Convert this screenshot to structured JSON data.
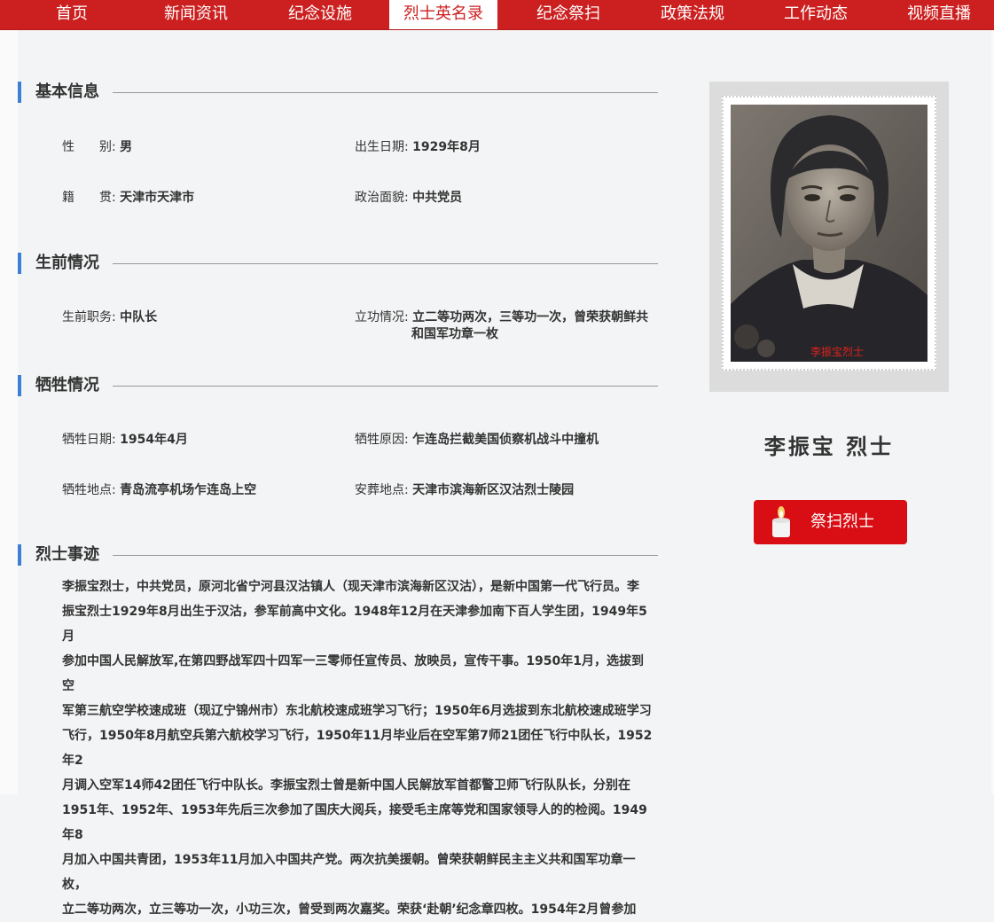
{
  "nav": {
    "items": [
      {
        "label": "首页"
      },
      {
        "label": "新闻资讯"
      },
      {
        "label": "纪念设施"
      },
      {
        "label": "烈士英名录"
      },
      {
        "label": "纪念祭扫"
      },
      {
        "label": "政策法规"
      },
      {
        "label": "工作动态"
      },
      {
        "label": "视频直播"
      }
    ],
    "active_index": 3
  },
  "sections": {
    "basic": {
      "title": "基本信息",
      "gender_label": "性　　别:",
      "gender": "男",
      "birth_label": "出生日期:",
      "birth": "1929年8月",
      "native_label": "籍　　贯:",
      "native": "天津市天津市",
      "political_label": "政治面貌:",
      "political": "中共党员"
    },
    "life": {
      "title": "生前情况",
      "post_label": "生前职务:",
      "post": "中队长",
      "merit_label": "立功情况:",
      "merit_line1": "立二等功两次，三等功一次，曾荣获朝鲜共",
      "merit_line2": "和国军功章一枚"
    },
    "sacrifice": {
      "title": "牺牲情况",
      "date_label": "牺牲日期:",
      "date": "1954年4月",
      "reason_label": "牺牲原因:",
      "reason": "乍连岛拦截美国侦察机战斗中撞机",
      "place_label": "牺牲地点:",
      "place": "青岛流亭机场乍连岛上空",
      "burial_label": "安葬地点:",
      "burial": "天津市滨海新区汉沽烈士陵园"
    },
    "deeds": {
      "title": "烈士事迹",
      "lines": [
        "李振宝烈士，中共党员，原河北省宁河县汉沽镇人（现天津市滨海新区汉沽），是新中国第一代飞行员。李",
        "振宝烈士1929年8月出生于汉沽，参军前高中文化。1948年12月在天津参加南下百人学生团，1949年5月",
        "参加中国人民解放军,在第四野战军四十四军一三零师任宣传员、放映员，宣传干事。1950年1月，选拔到空",
        "军第三航空学校速成班（现辽宁锦州市）东北航校速成班学习飞行；1950年6月选拔到东北航校速成班学习",
        "飞行，1950年8月航空兵第六航校学习飞行，1950年11月毕业后在空军第7师21团任飞行中队长，1952年2",
        "月调入空军14师42团任飞行中队长。李振宝烈士曾是新中国人民解放军首都警卫师飞行队队长，分别在",
        "1951年、1952年、1953年先后三次参加了国庆大阅兵，接受毛主席等党和国家领导人的的检阅。1949年8",
        "月加入中国共青团，1953年11月加入中国共产党。两次抗美援朝。曾荣获朝鲜民主主义共和国军功章一枚，",
        "立二等功两次，立三等功一次，小功三次，曾受到两次嘉奖。荣获‘赴朝’纪念章四枚。1954年2月曾参加"
      ]
    }
  },
  "photo": {
    "caption": "李振宝烈士"
  },
  "hero": {
    "name": "李振宝  烈士"
  },
  "tribute": {
    "label": "祭扫烈士",
    "icon": "candle-icon"
  },
  "colors": {
    "nav_bg": "#cc2020",
    "accent_bar": "#3d7fd4",
    "button_bg": "#d80e14"
  }
}
